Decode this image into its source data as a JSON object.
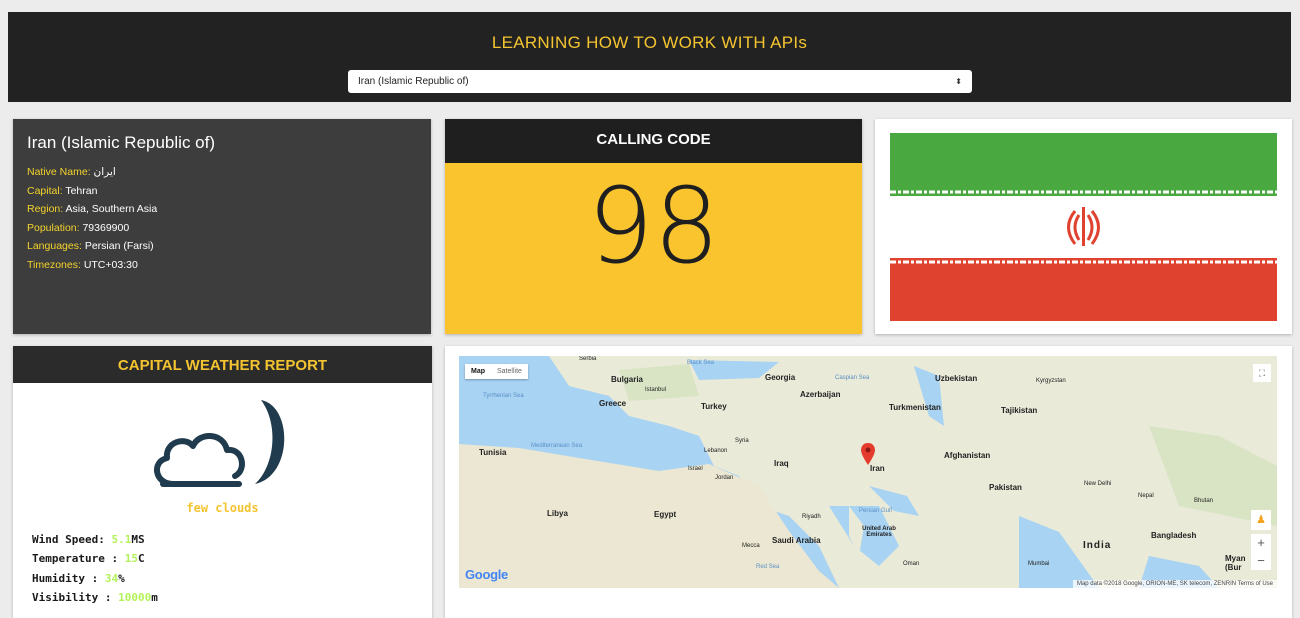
{
  "header": {
    "title": "LEARNING HOW TO WORK WITH APIs",
    "select_value": "Iran (Islamic Republic of)",
    "select_arrow": "⬍"
  },
  "info": {
    "name": "Iran (Islamic Republic of)",
    "native_label": "Native Name:",
    "native_value": "ایران",
    "capital_label": "Capital:",
    "capital_value": "Tehran",
    "region_label": "Region:",
    "region_value": "Asia, Southern Asia",
    "population_label": "Population:",
    "population_value": "79369900",
    "languages_label": "Languages:",
    "languages_value": "Persian (Farsi)",
    "timezones_label": "Timezones:",
    "timezones_value": "UTC+03:30"
  },
  "calling": {
    "title": "CALLING CODE",
    "code": "98"
  },
  "flag": {
    "icon": "iran-flag",
    "colors": {
      "green": "#4aa840",
      "white": "#ffffff",
      "red": "#e04230"
    }
  },
  "weather": {
    "title": "CAPITAL WEATHER REPORT",
    "icon": "cloud-moon-icon",
    "description": "few clouds",
    "wind_label": "Wind Speed: ",
    "wind_value": "5.1",
    "wind_unit": "MS",
    "temp_label": "Temperature : ",
    "temp_value": "15",
    "temp_unit": "C",
    "humidity_label": "Humidity : ",
    "humidity_value": "34",
    "humidity_unit": "%",
    "visibility_label": "Visibility : ",
    "visibility_value": "10000",
    "visibility_unit": "m"
  },
  "map": {
    "type_map": "Map",
    "type_satellite": "Satellite",
    "fullscreen_icon": "⛶",
    "pegman_icon": "♟",
    "zoom_in": "+",
    "zoom_out": "−",
    "attribution": "Map data ©2018 Google, ORION-ME, SK telecom, ZENRIN   Terms of Use",
    "logo": "Google",
    "marker_label": "Iran",
    "labels": {
      "bulgaria": "Bulgaria",
      "georgia": "Georgia",
      "uzbekistan": "Uzbekistan",
      "kyrgyzstan": "Kyrgyzstan",
      "greece": "Greece",
      "turkey": "Turkey",
      "azerbaijan": "Azerbaijan",
      "turkmenistan": "Turkmenistan",
      "tajikistan": "Tajikistan",
      "tunisia": "Tunisia",
      "syria": "Syria",
      "lebanon": "Lebanon",
      "iraq": "Iraq",
      "afghanistan": "Afghanistan",
      "israel": "Israel",
      "jordan": "Jordan",
      "pakistan": "Pakistan",
      "new_delhi": "New Delhi",
      "nepal": "Nepal",
      "bhutan": "Bhutan",
      "libya": "Libya",
      "egypt": "Egypt",
      "riyadh": "Riyadh",
      "uae": "United Arab Emirates",
      "saudi": "Saudi Arabia",
      "mecca": "Mecca",
      "oman": "Oman",
      "india": "India",
      "bangladesh": "Bangladesh",
      "mumbai": "Mumbai",
      "myanmar": "Myan (Bur",
      "black_sea": "Black Sea",
      "caspian_sea": "Caspian Sea",
      "tyrrhenian": "Tyrrhenian Sea",
      "mediterranean": "Mediterranean Sea",
      "persian_gulf": "Persian Gulf",
      "red_sea": "Red Sea",
      "istanbul": "Istanbul",
      "serbia": "Serbia"
    }
  }
}
